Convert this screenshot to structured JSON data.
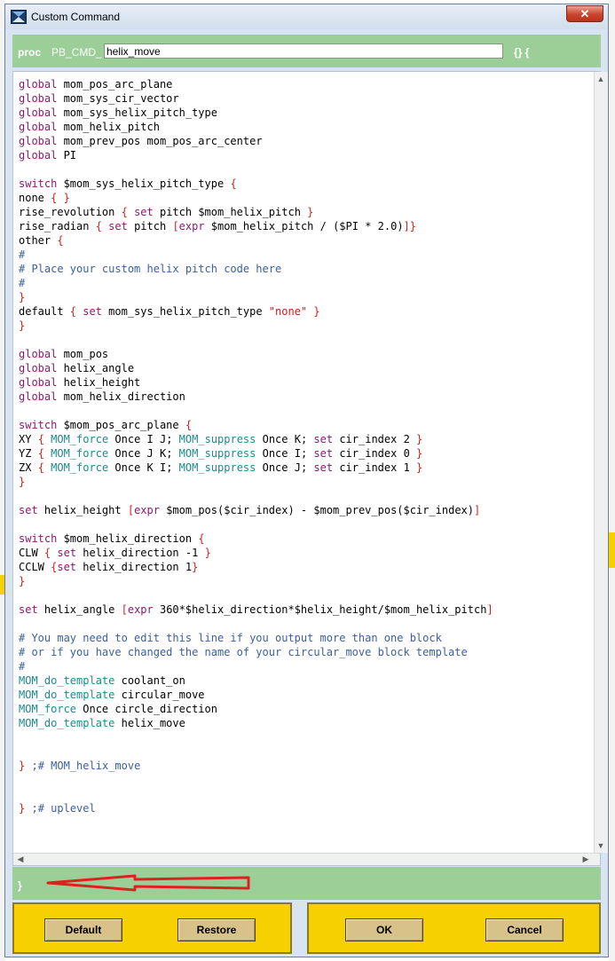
{
  "window": {
    "title": "Custom Command",
    "close_glyph": "✕"
  },
  "header": {
    "proc_keyword": "proc",
    "proc_prefix": "PB_CMD_",
    "proc_name": "helix_move",
    "brace": "{} {"
  },
  "code_lines": [
    [
      [
        "kw",
        "global"
      ],
      [
        "t",
        " mom_pos_arc_plane"
      ]
    ],
    [
      [
        "kw",
        "global"
      ],
      [
        "t",
        " mom_sys_cir_vector"
      ]
    ],
    [
      [
        "kw",
        "global"
      ],
      [
        "t",
        " mom_sys_helix_pitch_type"
      ]
    ],
    [
      [
        "kw",
        "global"
      ],
      [
        "t",
        " mom_helix_pitch"
      ]
    ],
    [
      [
        "kw",
        "global"
      ],
      [
        "t",
        " mom_prev_pos mom_pos_arc_center"
      ]
    ],
    [
      [
        "kw",
        "global"
      ],
      [
        "t",
        " PI"
      ]
    ],
    [],
    [
      [
        "kw",
        "switch"
      ],
      [
        "t",
        " $mom_sys_helix_pitch_type "
      ],
      [
        "br",
        "{"
      ]
    ],
    [
      [
        "t",
        "none "
      ],
      [
        "br",
        "{ }"
      ]
    ],
    [
      [
        "t",
        "rise_revolution "
      ],
      [
        "br",
        "{"
      ],
      [
        "t",
        " "
      ],
      [
        "kw",
        "set"
      ],
      [
        "t",
        " pitch $mom_helix_pitch "
      ],
      [
        "br",
        "}"
      ]
    ],
    [
      [
        "t",
        "rise_radian "
      ],
      [
        "br",
        "{"
      ],
      [
        "t",
        " "
      ],
      [
        "kw",
        "set"
      ],
      [
        "t",
        " pitch "
      ],
      [
        "br",
        "["
      ],
      [
        "kw",
        "expr"
      ],
      [
        "t",
        " $mom_helix_pitch / ($PI * 2.0)"
      ],
      [
        "br",
        "]}"
      ]
    ],
    [
      [
        "t",
        "other "
      ],
      [
        "br",
        "{"
      ]
    ],
    [
      [
        "cmt",
        "#"
      ]
    ],
    [
      [
        "cmt",
        "# Place your custom helix pitch code here"
      ]
    ],
    [
      [
        "cmt",
        "#"
      ]
    ],
    [
      [
        "br",
        "}"
      ]
    ],
    [
      [
        "t",
        "default "
      ],
      [
        "br",
        "{"
      ],
      [
        "t",
        " "
      ],
      [
        "kw",
        "set"
      ],
      [
        "t",
        " mom_sys_helix_pitch_type "
      ],
      [
        "str",
        "\"none\""
      ],
      [
        "t",
        " "
      ],
      [
        "br",
        "}"
      ]
    ],
    [
      [
        "br",
        "}"
      ]
    ],
    [],
    [
      [
        "kw",
        "global"
      ],
      [
        "t",
        " mom_pos"
      ]
    ],
    [
      [
        "kw",
        "global"
      ],
      [
        "t",
        " helix_angle"
      ]
    ],
    [
      [
        "kw",
        "global"
      ],
      [
        "t",
        " helix_height"
      ]
    ],
    [
      [
        "kw",
        "global"
      ],
      [
        "t",
        " mom_helix_direction"
      ]
    ],
    [],
    [
      [
        "kw",
        "switch"
      ],
      [
        "t",
        " $mom_pos_arc_plane "
      ],
      [
        "br",
        "{"
      ]
    ],
    [
      [
        "t",
        "XY "
      ],
      [
        "br",
        "{"
      ],
      [
        "t",
        " "
      ],
      [
        "cmd",
        "MOM_force"
      ],
      [
        "t",
        " Once I J; "
      ],
      [
        "cmd",
        "MOM_suppress"
      ],
      [
        "t",
        " Once K; "
      ],
      [
        "kw",
        "set"
      ],
      [
        "t",
        " cir_index 2 "
      ],
      [
        "br",
        "}"
      ]
    ],
    [
      [
        "t",
        "YZ "
      ],
      [
        "br",
        "{"
      ],
      [
        "t",
        " "
      ],
      [
        "cmd",
        "MOM_force"
      ],
      [
        "t",
        " Once J K; "
      ],
      [
        "cmd",
        "MOM_suppress"
      ],
      [
        "t",
        " Once I; "
      ],
      [
        "kw",
        "set"
      ],
      [
        "t",
        " cir_index 0 "
      ],
      [
        "br",
        "}"
      ]
    ],
    [
      [
        "t",
        "ZX "
      ],
      [
        "br",
        "{"
      ],
      [
        "t",
        " "
      ],
      [
        "cmd",
        "MOM_force"
      ],
      [
        "t",
        " Once K I; "
      ],
      [
        "cmd",
        "MOM_suppress"
      ],
      [
        "t",
        " Once J; "
      ],
      [
        "kw",
        "set"
      ],
      [
        "t",
        " cir_index 1 "
      ],
      [
        "br",
        "}"
      ]
    ],
    [
      [
        "br",
        "}"
      ]
    ],
    [],
    [
      [
        "kw",
        "set"
      ],
      [
        "t",
        " helix_height "
      ],
      [
        "br",
        "["
      ],
      [
        "kw",
        "expr"
      ],
      [
        "t",
        " $mom_pos($cir_index) - $mom_prev_pos($cir_index)"
      ],
      [
        "br",
        "]"
      ]
    ],
    [],
    [
      [
        "kw",
        "switch"
      ],
      [
        "t",
        " $mom_helix_direction "
      ],
      [
        "br",
        "{"
      ]
    ],
    [
      [
        "t",
        "CLW "
      ],
      [
        "br",
        "{"
      ],
      [
        "t",
        " "
      ],
      [
        "kw",
        "set"
      ],
      [
        "t",
        " helix_direction -1 "
      ],
      [
        "br",
        "}"
      ]
    ],
    [
      [
        "t",
        "CCLW "
      ],
      [
        "br",
        "{"
      ],
      [
        "kw",
        "set"
      ],
      [
        "t",
        " helix_direction 1"
      ],
      [
        "br",
        "}"
      ]
    ],
    [
      [
        "br",
        "}"
      ]
    ],
    [],
    [
      [
        "kw",
        "set"
      ],
      [
        "t",
        " helix_angle "
      ],
      [
        "br",
        "["
      ],
      [
        "kw",
        "expr"
      ],
      [
        "t",
        " 360*$helix_direction*$helix_height/$mom_helix_pitch"
      ],
      [
        "br",
        "]"
      ]
    ],
    [],
    [
      [
        "cmt",
        "# You may need to edit this line if you output more than one block"
      ]
    ],
    [
      [
        "cmt",
        "# or if you have changed the name of your circular_move block template"
      ]
    ],
    [
      [
        "cmt",
        "#"
      ]
    ],
    [
      [
        "cmd",
        "MOM_do_template"
      ],
      [
        "t",
        " coolant_on"
      ]
    ],
    [
      [
        "cmd",
        "MOM_do_template"
      ],
      [
        "t",
        " circular_move"
      ]
    ],
    [
      [
        "cmd",
        "MOM_force"
      ],
      [
        "t",
        " Once circle_direction"
      ]
    ],
    [
      [
        "cmd",
        "MOM_do_template"
      ],
      [
        "t",
        " helix_move"
      ]
    ],
    [],
    [],
    [
      [
        "br",
        "}"
      ],
      [
        "t",
        " "
      ],
      [
        "cmt",
        ";# MOM_helix_move"
      ]
    ],
    [],
    [],
    [
      [
        "br",
        "}"
      ],
      [
        "t",
        " "
      ],
      [
        "cmt",
        ";# uplevel"
      ]
    ]
  ],
  "closing_brace": "}",
  "buttons": {
    "default": "Default",
    "restore": "Restore",
    "ok": "OK",
    "cancel": "Cancel"
  },
  "colors": {
    "keyword": "#8b1a6b",
    "command": "#1e8a8a",
    "bracket": "#d11f1f",
    "comment": "#3c5fa0",
    "green_bar": "#9ccf98",
    "button_panel": "#f6d000",
    "annotation_arrow": "#e02020"
  },
  "icons": {
    "app": "app-icon",
    "close": "close-icon",
    "scroll_up": "scroll-up-icon",
    "scroll_down": "scroll-down-icon",
    "scroll_left": "scroll-left-icon",
    "scroll_right": "scroll-right-icon",
    "annotation": "red-arrow-annotation-icon"
  }
}
